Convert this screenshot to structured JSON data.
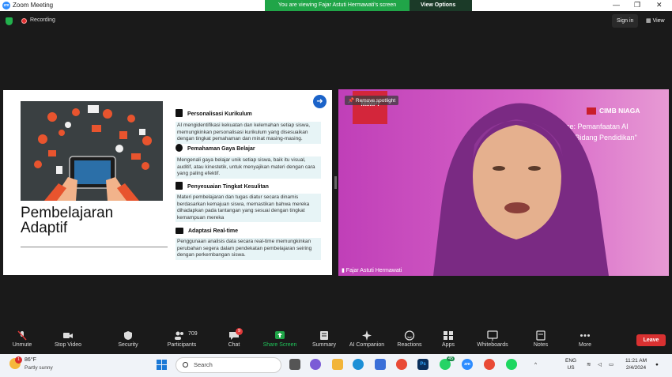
{
  "window": {
    "title": "Zoom Meeting",
    "banner_message": "You are viewing Fajar Astuti Hermawati's screen",
    "view_options": "View Options"
  },
  "topbar": {
    "recording": "Recording",
    "sign_in": "Sign in",
    "view": "View"
  },
  "slide": {
    "title_line1": "Pembelajaran",
    "title_line2": "Adaptif",
    "sections": [
      {
        "heading": "Personalisasi Kurikulum",
        "body": "AI mengidentifikasi kekuatan dan kelemahan setiap siswa, memungkinkan personalisasi kurikulum yang disesuaikan dengan tingkat pemahaman dan minat masing-masing."
      },
      {
        "heading": "Pemahaman Gaya Belajar",
        "body": "Mengenali gaya belajar unik setiap siswa, baik itu visual, auditif, atau kinestetik, untuk menyajikan materi dengan cara yang paling efektif."
      },
      {
        "heading": "Penyesuaian Tingkat Kesulitan",
        "body": "Materi pembelajaran dan tugas diatur secara dinamis berdasarkan kemajuan siswa, memastikan bahwa mereka dihadapkan pada tantangan yang sesuai dengan tingkat kemampuan mereka"
      },
      {
        "heading": "Adaptasi Real-time",
        "body": "Penggunaan analisis data secara real-time memungkinkan perubahan segera dalam pendekatan pembelajaran seiring dengan perkembangan siswa."
      }
    ]
  },
  "video": {
    "spotlight_label": "Remove spotlight",
    "mimpi_label": "MIMPI",
    "brand": "CIMB NIAGA",
    "caption_line1": "elligence: Pemanfaatan AI",
    "caption_line2": "di Bidang Pendidikan\"",
    "participant_name": "Fajar Astuti Hermawati"
  },
  "toolbar": {
    "unmute": "Unmute",
    "stop_video": "Stop Video",
    "security": "Security",
    "participants": "Participants",
    "participants_count": "709",
    "chat": "Chat",
    "chat_badge": "9",
    "share_screen": "Share Screen",
    "summary": "Summary",
    "ai_companion": "AI Companion",
    "reactions": "Reactions",
    "apps": "Apps",
    "whiteboards": "Whiteboards",
    "notes": "Notes",
    "more": "More",
    "leave": "Leave"
  },
  "taskbar": {
    "weather_temp": "86°F",
    "weather_desc": "Partly sunny",
    "weather_badge": "1",
    "search": "Search",
    "whatsapp_badge": "45",
    "lang_line1": "ENG",
    "lang_line2": "US",
    "time": "11:21 AM",
    "date": "2/4/2024"
  },
  "colors": {
    "share_green": "#20a548",
    "leave_red": "#d93131",
    "video_bg": "#c84db7",
    "slide_arrow": "#1b63c9"
  }
}
